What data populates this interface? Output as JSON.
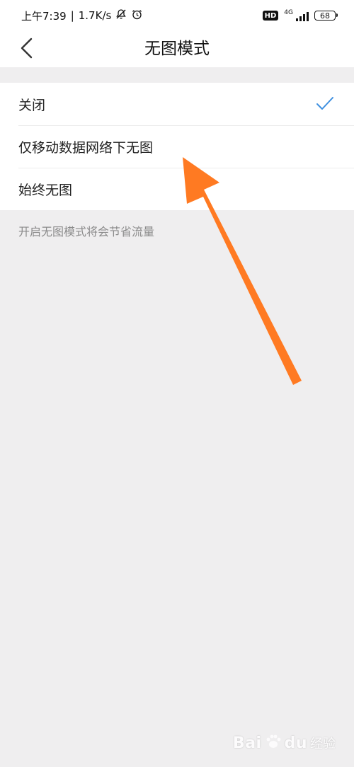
{
  "status_bar": {
    "time": "上午7:39",
    "speed": "1.7K/s",
    "hd_badge": "HD",
    "network": "4G",
    "battery": "68",
    "icons": [
      "bell-off-icon",
      "alarm-clock-icon",
      "signal-icon",
      "battery-icon"
    ]
  },
  "header": {
    "title": "无图模式",
    "back_icon": "chevron-left-icon"
  },
  "options": [
    {
      "label": "关闭",
      "selected": true
    },
    {
      "label": "仅移动数据网络下无图",
      "selected": false
    },
    {
      "label": "始终无图",
      "selected": false
    }
  ],
  "hint": "开启无图模式将会节省流量",
  "watermark": {
    "brand": "Bai",
    "brand_2": "du",
    "suffix": "经验"
  },
  "colors": {
    "check": "#3d8fe0",
    "annotation_arrow": "#ff7a22",
    "background": "#efeeef"
  }
}
